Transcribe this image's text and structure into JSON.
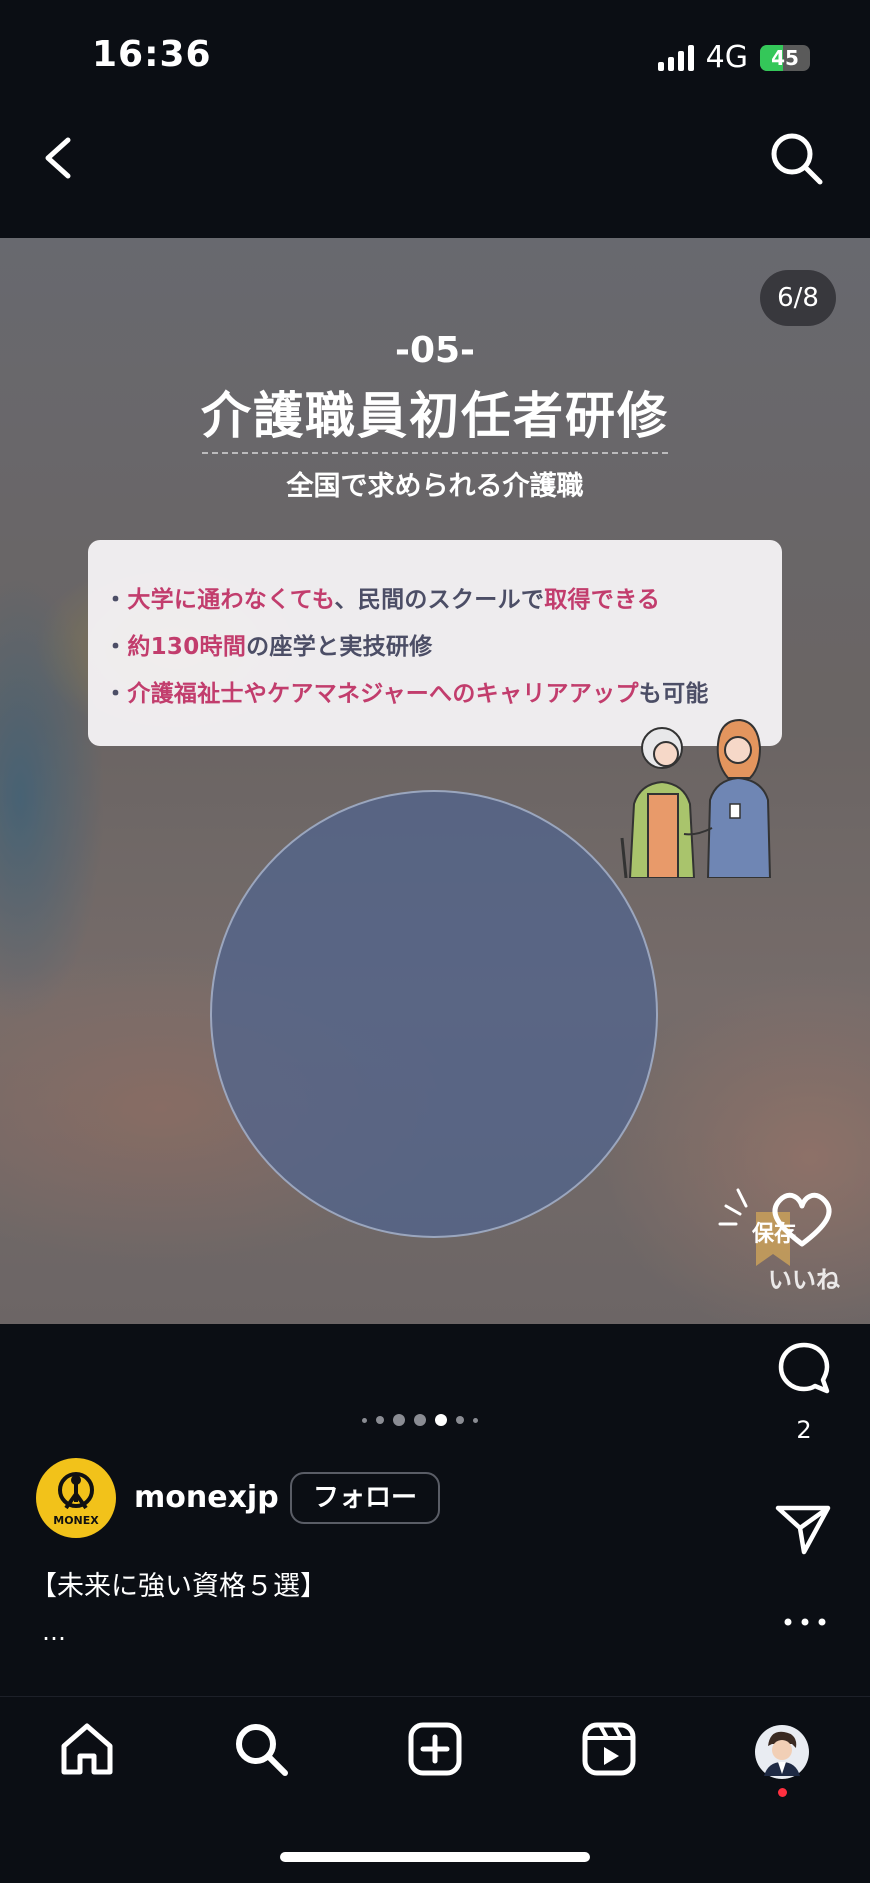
{
  "status_bar": {
    "time": "16:36",
    "network": "4G",
    "battery": "45"
  },
  "post": {
    "page_counter": "6/8",
    "slide": {
      "number": "-05-",
      "title": "介護職員初任者研修",
      "subtitle": "全国で求められる介護職",
      "lines": [
        [
          "・",
          "大学に通わなくても",
          "、民間のスクールで",
          "取得できる"
        ],
        [
          "・",
          "約130時間",
          "の座学と実技研修",
          ""
        ],
        [
          "・",
          "介護福祉士やケアマネジャーへのキャリアアップ",
          "も可能",
          ""
        ]
      ],
      "save_label": "保存",
      "like_label": "いいね"
    },
    "comment_count": "2",
    "carousel": {
      "current": 4,
      "count": 7
    }
  },
  "account": {
    "username": "monexjp",
    "avatar_text": "MONEX",
    "follow_label": "フォロー"
  },
  "caption": {
    "text": "【未来に強い資格５選】",
    "more": "…"
  },
  "colors": {
    "background": "#0b0e14",
    "accent_pink": "#c23d6d",
    "avatar_yellow": "#f2c21a",
    "notification": "#ff3040"
  },
  "nav": [
    "home-icon",
    "search-icon",
    "create-icon",
    "reels-icon",
    "profile-avatar"
  ]
}
